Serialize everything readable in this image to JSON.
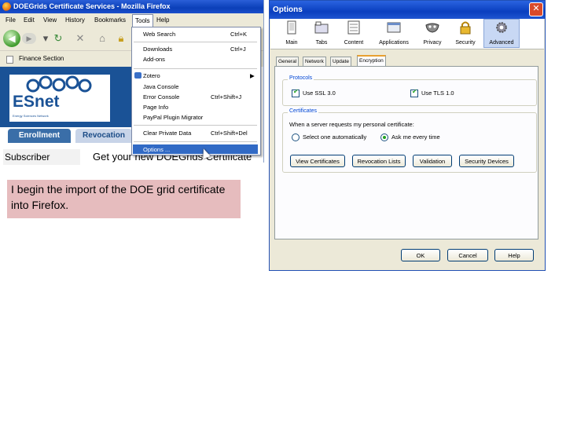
{
  "firefox": {
    "title": "DOEGrids Certificate Services - Mozilla Firefox",
    "menu": [
      "File",
      "Edit",
      "View",
      "History",
      "Bookmarks",
      "Tools",
      "Help"
    ],
    "bookmark_tab": "Finance Section",
    "esnet_logo_text": "ESnet",
    "esnet_logo_subtitle": "Energy Sciences Network",
    "tabs": [
      "Enrollment",
      "Revocation"
    ],
    "subscriber": "Subscriber",
    "page_heading": "Get your new DOEGrids Certificate"
  },
  "tools_menu": {
    "items": [
      {
        "label": "Web Search",
        "shortcut": "Ctrl+K"
      },
      {
        "label": "Downloads",
        "shortcut": "Ctrl+J"
      },
      {
        "label": "Add-ons",
        "shortcut": ""
      },
      {
        "label": "Zotero",
        "shortcut": "▶"
      },
      {
        "label": "Java Console",
        "shortcut": ""
      },
      {
        "label": "Error Console",
        "shortcut": "Ctrl+Shift+J"
      },
      {
        "label": "Page Info",
        "shortcut": ""
      },
      {
        "label": "PayPal Plugin Migrator",
        "shortcut": ""
      },
      {
        "label": "Clear Private Data",
        "shortcut": "Ctrl+Shift+Del"
      },
      {
        "label": "Options ...",
        "shortcut": ""
      }
    ]
  },
  "caption": "I begin the import of the DOE grid certificate into Firefox.",
  "options": {
    "title": "Options",
    "close": "✕",
    "toolbar": [
      "Main",
      "Tabs",
      "Content",
      "Applications",
      "Privacy",
      "Security",
      "Advanced"
    ],
    "subtabs": [
      "General",
      "Network",
      "Update",
      "Encryption"
    ],
    "protocols_label": "Protocols",
    "ssl_label": "Use SSL 3.0",
    "tls_label": "Use TLS 1.0",
    "certificates_label": "Certificates",
    "cert_prompt": "When a server requests my personal certificate:",
    "radio_auto": "Select one automatically",
    "radio_ask": "Ask me every time",
    "cert_buttons": [
      "View Certificates",
      "Revocation Lists",
      "Validation",
      "Security Devices"
    ],
    "ok": "OK",
    "cancel": "Cancel",
    "help": "Help"
  },
  "colors": {
    "caption_bg": "#e6bcbe",
    "esnet_blue": "#1a5296",
    "xp_title_blue": "#0a3fbf",
    "menu_highlight": "#316ac5"
  }
}
